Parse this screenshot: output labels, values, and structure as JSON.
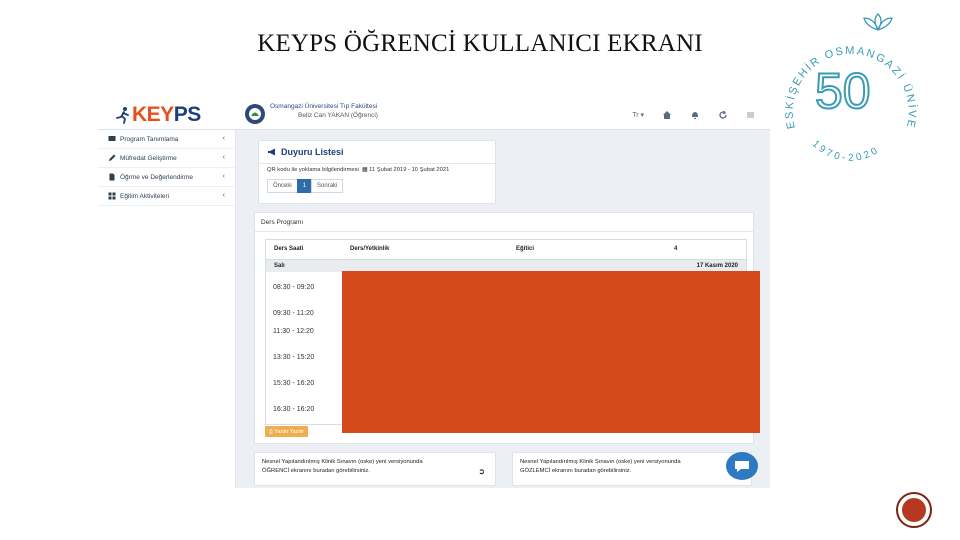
{
  "slide": {
    "title": "KEYPS ÖĞRENCİ KULLANICI EKRANI"
  },
  "logo": {
    "arc_text": "ESKİŞEHİR OSMANGAZİ ÜNİVERSİTESİ",
    "years": "1970-2020",
    "number": "50",
    "color": "#3a9bb5"
  },
  "app": {
    "brand_key": "KEY",
    "brand_ps": "PS",
    "brand_color_orange": "#e8501b",
    "brand_color_navy": "#1f3f7a",
    "university": "Osmangazi Üniversitesi Tıp Fakültesi",
    "user": "Beliz Can YAKAN (Öğrenci)",
    "lang": "Tr ▾",
    "top_icons": [
      "home-icon",
      "bell-icon",
      "refresh-icon",
      "flag-icon"
    ]
  },
  "sidebar": {
    "items": [
      {
        "label": "Program Tanımlama",
        "icon": "monitor-icon"
      },
      {
        "label": "Müfredat Geliştirme",
        "icon": "pencil-icon"
      },
      {
        "label": "Öğrme ve Değerlendirme",
        "icon": "document-icon"
      },
      {
        "label": "Eğitim Aktiviteleri",
        "icon": "grid-icon"
      }
    ]
  },
  "announcements": {
    "title": "Duyuru Listesi",
    "item": "QR kodu ile yoklama bilgilendirmesi",
    "date_range": "11 Şubat 2019 - 10 Şubat 2021",
    "prev": "Önceki",
    "page": "1",
    "next": "Sonraki"
  },
  "program": {
    "title": "Ders Programı",
    "columns": [
      "Ders Saati",
      "Ders/Yetkinlik",
      "Eğitici",
      "4"
    ],
    "day": "Salı",
    "date": "17 Kasım 2020",
    "times": [
      "08:30 - 09:20",
      "09:30 - 11:20",
      "11:30 - 12:20",
      "13:30 - 15:20",
      "15:30 - 16:20",
      "16:30 - 16:20"
    ],
    "print_label": "Yazdır Yazdır",
    "redaction_color": "#d44a1b"
  },
  "cards": {
    "card1_line1": "Nesnel Yapılandırılmış Klinik Sınavın (oske) yeni versiyonunda",
    "card1_line2": "ÖĞRENCİ ekranını buradan görebilirsiniz.",
    "card2_line1": "Nesnel Yapılandırılmış Klinik Sınavın (oske) yeni versiyonunda",
    "card2_line2": "GÖZLEMCİ ekranını buradan görebilirsiniz."
  }
}
